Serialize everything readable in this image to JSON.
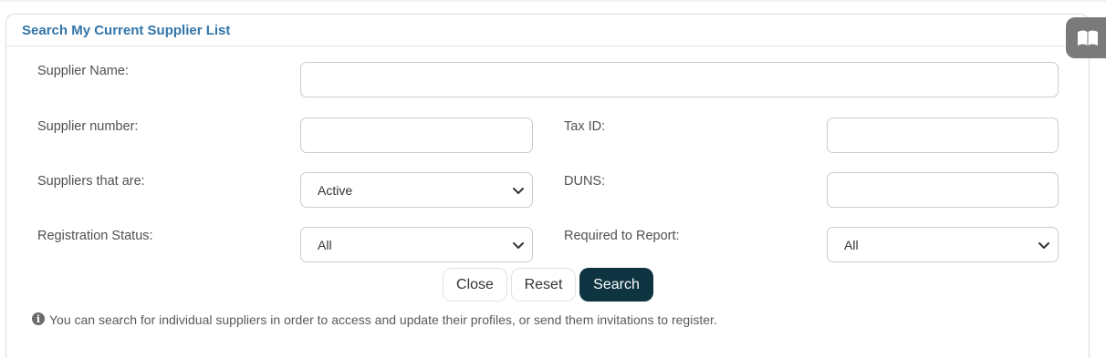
{
  "panel": {
    "title": "Search My Current Supplier List"
  },
  "fields": {
    "supplier_name": {
      "label": "Supplier Name:",
      "value": ""
    },
    "supplier_number": {
      "label": "Supplier number:",
      "value": ""
    },
    "tax_id": {
      "label": "Tax ID:",
      "value": ""
    },
    "suppliers_that_are": {
      "label": "Suppliers that are:",
      "value": "Active"
    },
    "duns": {
      "label": "DUNS:",
      "value": ""
    },
    "registration_status": {
      "label": "Registration Status:",
      "value": "All"
    },
    "required_to_report": {
      "label": "Required to Report:",
      "value": "All"
    }
  },
  "buttons": {
    "close": "Close",
    "reset": "Reset",
    "search": "Search"
  },
  "info": {
    "text": "You can search for individual suppliers in order to access and update their profiles, or send them invitations to register."
  },
  "icons": {
    "info": "info-circle-icon",
    "side_tab": "book-icon",
    "select_arrow": "chevron-down-icon"
  },
  "colors": {
    "title": "#3275a9",
    "primary_button": "#0e3441",
    "side_tab": "#7a7a7a"
  }
}
